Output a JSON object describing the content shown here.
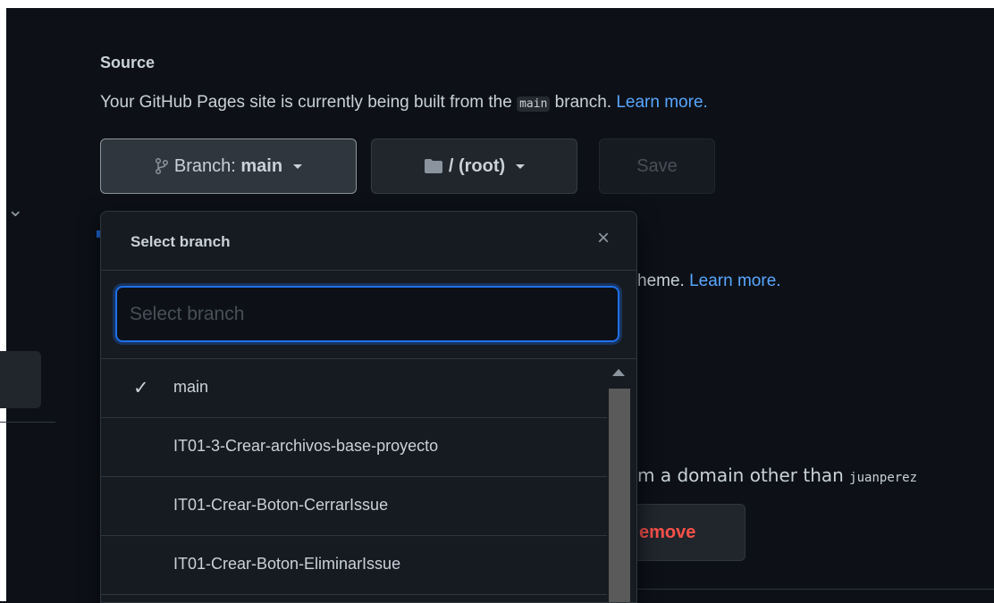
{
  "source": {
    "title": "Source",
    "desc_prefix": "Your GitHub Pages site is currently being built from the ",
    "desc_branch": "main",
    "desc_suffix": " branch. ",
    "learn_more": "Learn more."
  },
  "buttons": {
    "branch_prefix": "Branch: ",
    "branch_value": "main",
    "root_label": "/ (root)",
    "save_label": "Save"
  },
  "background": {
    "theme_text": "heme. ",
    "theme_link": "Learn more.",
    "domain_text": "m a domain other than ",
    "domain_code": "juanperez",
    "remove_label": "emove"
  },
  "dropdown": {
    "title": "Select branch",
    "close_glyph": "×",
    "placeholder": "Select branch",
    "check_glyph": "✓",
    "items": [
      {
        "name": "main",
        "selected": true
      },
      {
        "name": "IT01-3-Crear-archivos-base-proyecto",
        "selected": false
      },
      {
        "name": "IT01-Crear-Boton-CerrarIssue",
        "selected": false
      },
      {
        "name": "IT01-Crear-Boton-EliminarIssue",
        "selected": false
      }
    ]
  },
  "colors": {
    "background": "#0d1117",
    "accent": "#1f6feb",
    "link": "#58a6ff",
    "danger": "#f85149"
  }
}
